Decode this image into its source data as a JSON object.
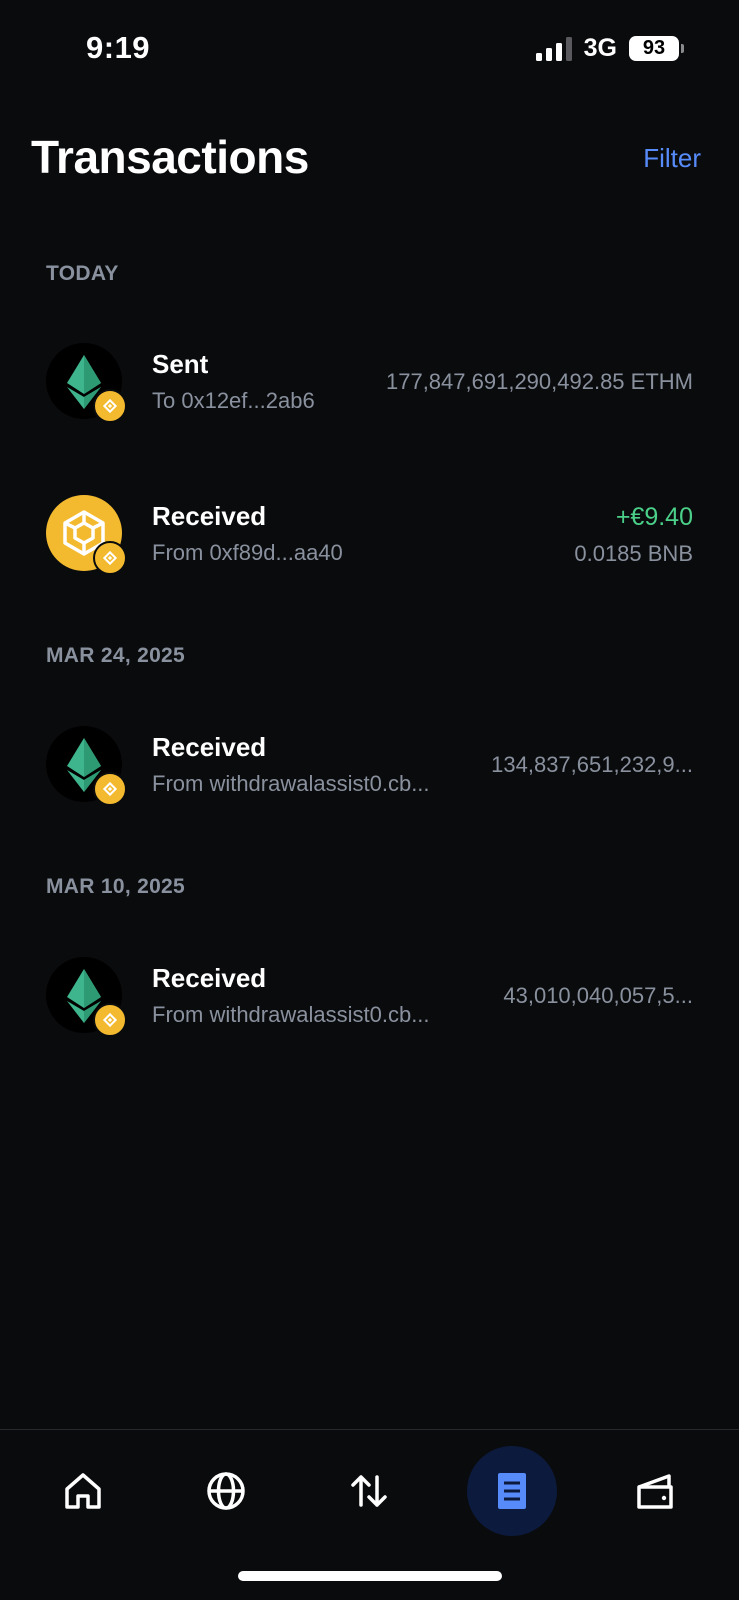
{
  "status": {
    "time": "9:19",
    "network": "3G",
    "battery": "93"
  },
  "header": {
    "title": "Transactions",
    "filter_label": "Filter"
  },
  "sections": [
    {
      "label": "TODAY",
      "transactions": [
        {
          "title": "Sent",
          "subtitle": "To 0x12ef...2ab6",
          "amount": "177,847,691,290,492.85 ETHM",
          "icon": "ethm-token-icon"
        },
        {
          "title": "Received",
          "subtitle": "From 0xf89d...aa40",
          "fiat": "+€9.40",
          "crypto": "0.0185 BNB",
          "icon": "bnb-token-icon"
        }
      ]
    },
    {
      "label": "MAR 24, 2025",
      "transactions": [
        {
          "title": "Received",
          "subtitle": "From withdrawalassist0.cb...",
          "amount": "134,837,651,232,9...",
          "icon": "ethm-token-icon"
        }
      ]
    },
    {
      "label": "MAR 10, 2025",
      "transactions": [
        {
          "title": "Received",
          "subtitle": "From withdrawalassist0.cb...",
          "amount": "43,010,040,057,5...",
          "icon": "ethm-token-icon"
        }
      ]
    }
  ],
  "nav": [
    "home-icon",
    "globe-icon",
    "swap-arrows-icon",
    "transactions-icon",
    "wallet-icon"
  ],
  "colors": {
    "accent": "#578bfa",
    "positive": "#4bd08a",
    "muted": "#8a919e",
    "background": "#0a0b0d",
    "bnb": "#f3ba2f"
  }
}
